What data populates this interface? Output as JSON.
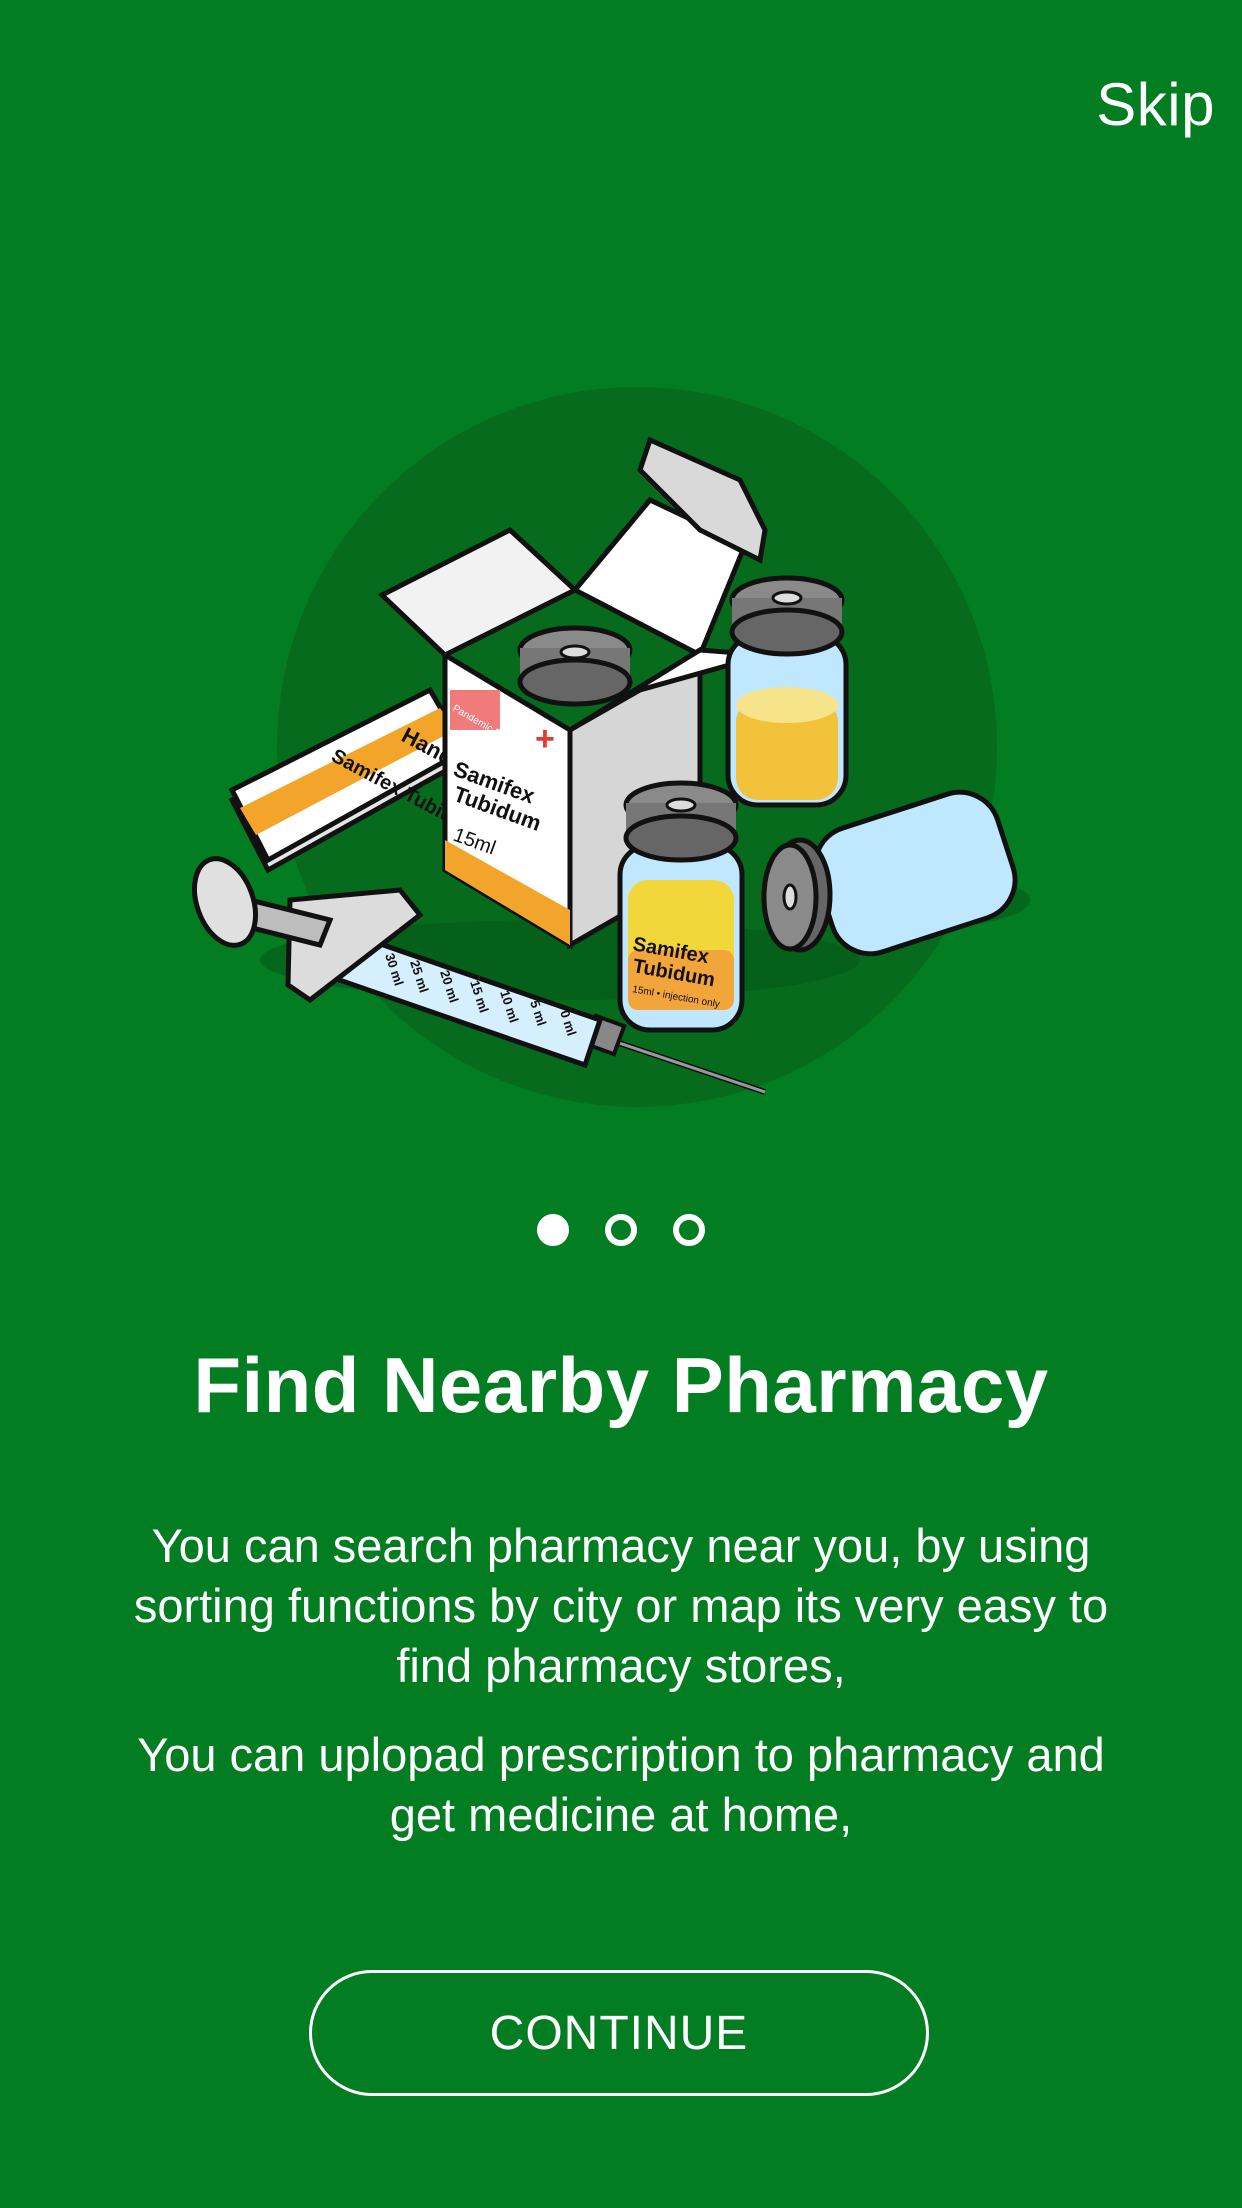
{
  "header": {
    "skip_label": "Skip"
  },
  "illustration": {
    "icon": "pharmacy-medicine-illustration",
    "manual_title": "Hand Manual",
    "manual_product": "Samifex Tubidum",
    "box_brand": "Pandemic Solutions",
    "box_product_line1": "Samifex",
    "box_product_line2": "Tubidum",
    "box_volume": "15ml",
    "vial_label_line1": "Samifex",
    "vial_label_line2": "Tubidum",
    "vial_label_detail": "15ml • injection only",
    "syringe_marks": [
      "30 ml",
      "25 ml",
      "20 ml",
      "15 ml",
      "10 ml",
      "5 ml",
      "0 ml"
    ]
  },
  "pager": {
    "total": 3,
    "active_index": 0
  },
  "content": {
    "title": "Find Nearby Pharmacy",
    "paragraph1": "You can search pharmacy near you, by using sorting functions by city or map its very easy to find pharmacy stores,",
    "paragraph2": "You can uplopad prescription to pharmacy and get medicine at home,"
  },
  "actions": {
    "continue_label": "CONTINUE"
  },
  "colors": {
    "background": "#027d22",
    "circle": "#066b1c",
    "text": "#ffffff"
  }
}
